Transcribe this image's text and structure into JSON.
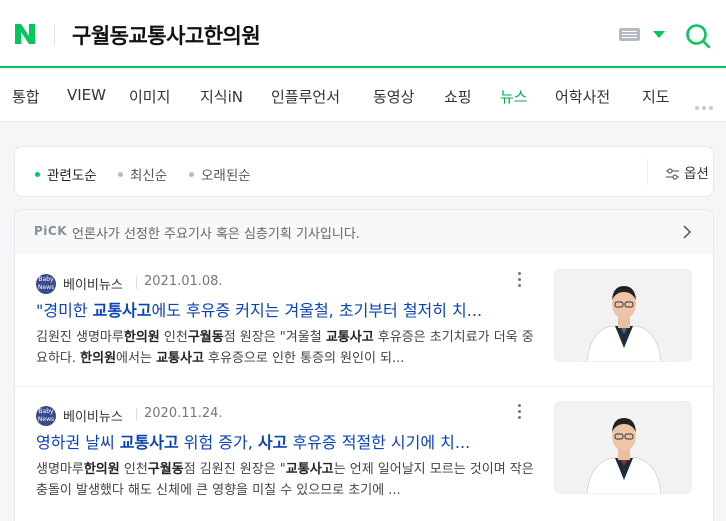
{
  "header": {
    "logo_letter": "N",
    "query": "구월동교통사고한의원",
    "brand_color": "#03c75a"
  },
  "tabs": [
    {
      "label": "통합",
      "active": false
    },
    {
      "label": "VIEW",
      "active": false
    },
    {
      "label": "이미지",
      "active": false
    },
    {
      "label": "지식iN",
      "active": false
    },
    {
      "label": "인플루언서",
      "active": false
    },
    {
      "label": "동영상",
      "active": false
    },
    {
      "label": "쇼핑",
      "active": false
    },
    {
      "label": "뉴스",
      "active": true
    },
    {
      "label": "어학사전",
      "active": false
    },
    {
      "label": "지도",
      "active": false
    }
  ],
  "sort": {
    "options": [
      "관련도순",
      "최신순",
      "오래된순"
    ],
    "selected": "관련도순",
    "option_button": "옵션"
  },
  "pick": {
    "badge": "PiCK",
    "text": "언론사가 선정한 주요기사 혹은 심층기획 기사입니다."
  },
  "articles": [
    {
      "press": "베이비뉴스",
      "date": "2021.01.08.",
      "title_parts": [
        {
          "t": "\"경미한 ",
          "b": false
        },
        {
          "t": "교통사고",
          "b": true
        },
        {
          "t": "에도 후유증 커지는 겨울철, 초기부터 철저히 치...",
          "b": false
        }
      ],
      "desc_parts": [
        {
          "t": "김원진 생명마루",
          "b": false
        },
        {
          "t": "한의원",
          "b": true
        },
        {
          "t": " 인천",
          "b": false
        },
        {
          "t": "구월동",
          "b": true
        },
        {
          "t": "점 원장은 \"겨울철 ",
          "b": false
        },
        {
          "t": "교통사고",
          "b": true
        },
        {
          "t": " 후유증은 초기치료가 더욱 중요하다. ",
          "b": false
        },
        {
          "t": "한의원",
          "b": true
        },
        {
          "t": "에서는 ",
          "b": false
        },
        {
          "t": "교통사고",
          "b": true
        },
        {
          "t": " 후유증으로 인한 통증의 원인이 되...",
          "b": false
        }
      ]
    },
    {
      "press": "베이비뉴스",
      "date": "2020.11.24.",
      "title_parts": [
        {
          "t": "영하권 날씨 ",
          "b": false
        },
        {
          "t": "교통사고",
          "b": true
        },
        {
          "t": " 위험 증가, ",
          "b": false
        },
        {
          "t": "사고",
          "b": true
        },
        {
          "t": " 후유증 적절한 시기에 치...",
          "b": false
        }
      ],
      "desc_parts": [
        {
          "t": "생명마루",
          "b": false
        },
        {
          "t": "한의원",
          "b": true
        },
        {
          "t": " 인천",
          "b": false
        },
        {
          "t": "구월동",
          "b": true
        },
        {
          "t": "점 김원진 원장은 \"",
          "b": false
        },
        {
          "t": "교통사고",
          "b": true
        },
        {
          "t": "는 언제 일어날지 모르는 것이며 작은 충돌이 발생했다 해도 신체에 큰 영향을 미칠 수 있으므로 초기에 ...",
          "b": false
        }
      ]
    }
  ],
  "press_logo_text": "Baby News"
}
